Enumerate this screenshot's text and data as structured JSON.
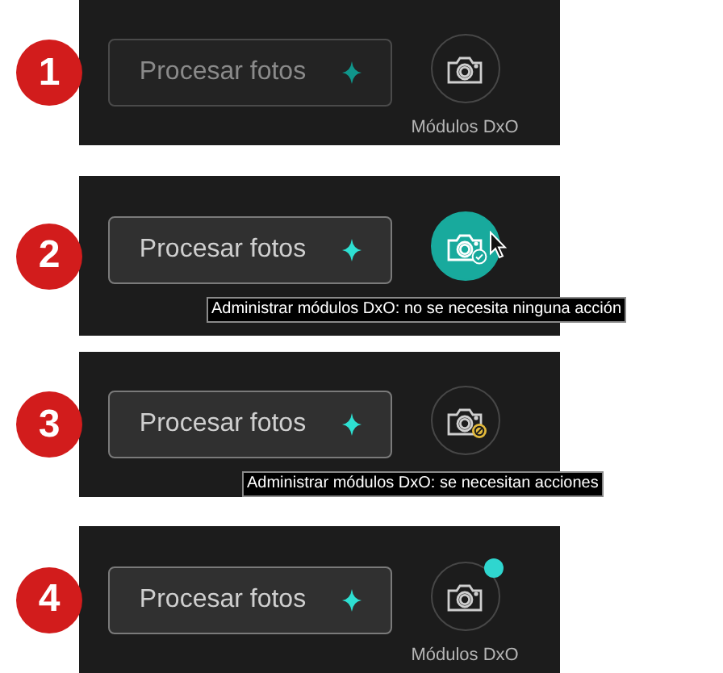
{
  "steps": [
    {
      "number": "1",
      "button": {
        "label": "Procesar fotos",
        "disabled": true
      },
      "modules": {
        "hovered": false,
        "kind": "plain",
        "update_dot": false,
        "caption": "Módulos DxO"
      }
    },
    {
      "number": "2",
      "button": {
        "label": "Procesar fotos",
        "disabled": false
      },
      "modules": {
        "hovered": true,
        "kind": "ok",
        "update_dot": false,
        "tooltip": "Administrar módulos DxO: no se necesita ninguna acción"
      }
    },
    {
      "number": "3",
      "button": {
        "label": "Procesar fotos",
        "disabled": false
      },
      "modules": {
        "hovered": false,
        "kind": "warning",
        "update_dot": false,
        "tooltip": "Administrar módulos DxO: se necesitan acciones"
      }
    },
    {
      "number": "4",
      "button": {
        "label": "Procesar fotos",
        "disabled": false
      },
      "modules": {
        "hovered": false,
        "kind": "plain",
        "update_dot": true,
        "caption": "Módulos DxO"
      }
    }
  ]
}
